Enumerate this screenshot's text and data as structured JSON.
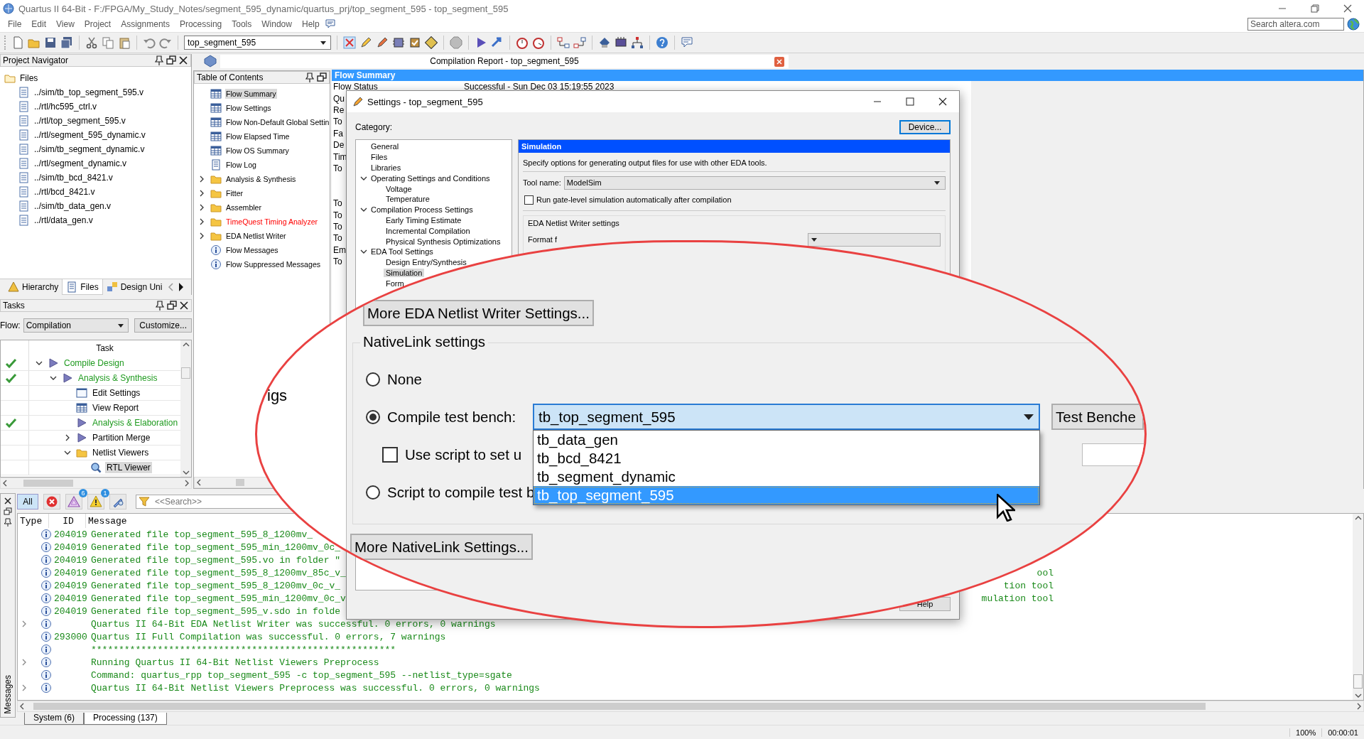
{
  "window": {
    "title": "Quartus II 64-Bit - F:/FPGA/My_Study_Notes/segment_595_dynamic/quartus_prj/top_segment_595 - top_segment_595"
  },
  "menu": [
    "File",
    "Edit",
    "View",
    "Project",
    "Assignments",
    "Processing",
    "Tools",
    "Window",
    "Help"
  ],
  "search": {
    "placeholder": "Search altera.com"
  },
  "toolbar": {
    "project_combo": "top_segment_595"
  },
  "project_navigator": {
    "title": "Project Navigator",
    "root": "Files",
    "files": [
      "../sim/tb_top_segment_595.v",
      "../rtl/hc595_ctrl.v",
      "../rtl/top_segment_595.v",
      "../rtl/segment_595_dynamic.v",
      "../sim/tb_segment_dynamic.v",
      "../rtl/segment_dynamic.v",
      "../sim/tb_bcd_8421.v",
      "../rtl/bcd_8421.v",
      "../sim/tb_data_gen.v",
      "../rtl/data_gen.v"
    ],
    "tabs": [
      {
        "label": "Hierarchy",
        "kind": "hierarchy",
        "selected": false
      },
      {
        "label": "Files",
        "kind": "files",
        "selected": true
      },
      {
        "label": "Design Uni",
        "kind": "units",
        "selected": false
      }
    ]
  },
  "tasks": {
    "title": "Tasks",
    "flow_label": "Flow:",
    "flow": "Compilation",
    "customize": "Customize...",
    "column": "Task",
    "items": [
      {
        "label": "Compile Design",
        "kind": "flow",
        "done": true,
        "selected": false,
        "expanded": true,
        "children": [
          {
            "label": "Analysis & Synthesis",
            "kind": "flow",
            "done": true,
            "selected": false,
            "expanded": true,
            "children": [
              {
                "label": "Edit Settings",
                "kind": "settings",
                "done": false,
                "selected": false
              },
              {
                "label": "View Report",
                "kind": "report",
                "done": false,
                "selected": false
              },
              {
                "label": "Analysis & Elaboration",
                "kind": "flow",
                "done": true,
                "selected": false
              },
              {
                "label": "Partition Merge",
                "kind": "flow",
                "done": false,
                "selected": false,
                "expanded": false
              },
              {
                "label": "Netlist Viewers",
                "kind": "folder",
                "done": false,
                "selected": false,
                "expanded": true,
                "children": [
                  {
                    "label": "RTL Viewer",
                    "kind": "viewer",
                    "done": false,
                    "selected": true
                  }
                ]
              }
            ]
          }
        ]
      }
    ]
  },
  "report_tab": {
    "title": "Compilation Report - top_segment_595"
  },
  "toc": {
    "title": "Table of Contents",
    "items": [
      {
        "label": "Flow Summary",
        "kind": "table",
        "selected": true,
        "failed": false
      },
      {
        "label": "Flow Settings",
        "kind": "table",
        "selected": false,
        "failed": false
      },
      {
        "label": "Flow Non-Default Global Settin",
        "kind": "table",
        "selected": false,
        "failed": false
      },
      {
        "label": "Flow Elapsed Time",
        "kind": "table",
        "selected": false,
        "failed": false
      },
      {
        "label": "Flow OS Summary",
        "kind": "table",
        "selected": false,
        "failed": false
      },
      {
        "label": "Flow Log",
        "kind": "log",
        "selected": false,
        "failed": false
      },
      {
        "label": "Analysis & Synthesis",
        "kind": "folder",
        "expanded": false,
        "selected": false,
        "failed": false
      },
      {
        "label": "Fitter",
        "kind": "folder",
        "expanded": false,
        "selected": false,
        "failed": false
      },
      {
        "label": "Assembler",
        "kind": "folder",
        "expanded": false,
        "selected": false,
        "failed": false
      },
      {
        "label": "TimeQuest Timing Analyzer",
        "kind": "folder",
        "expanded": false,
        "selected": false,
        "failed": true
      },
      {
        "label": "EDA Netlist Writer",
        "kind": "folder",
        "expanded": false,
        "selected": false,
        "failed": false
      },
      {
        "label": "Flow Messages",
        "kind": "info",
        "selected": false,
        "failed": false
      },
      {
        "label": "Flow Suppressed Messages",
        "kind": "info",
        "selected": false,
        "failed": false
      }
    ]
  },
  "report": {
    "title": "Flow Summary",
    "rows": [
      {
        "kind": "row",
        "label": "Flow Status",
        "value": "Successful - Sun Dec 03 15:19:55 2023"
      },
      {
        "kind": "row",
        "label": "Qu"
      },
      {
        "kind": "row",
        "label": "Re"
      },
      {
        "kind": "row",
        "label": "To"
      },
      {
        "kind": "row",
        "label": "Fa"
      },
      {
        "kind": "row",
        "label": "De"
      },
      {
        "kind": "row",
        "label": "Tim"
      },
      {
        "kind": "row",
        "label": "To"
      },
      {
        "kind": "blank"
      },
      {
        "kind": "blank"
      },
      {
        "kind": "row",
        "label": "To"
      },
      {
        "kind": "row",
        "label": "To"
      },
      {
        "kind": "row",
        "label": "To"
      },
      {
        "kind": "row",
        "label": "To"
      },
      {
        "kind": "row",
        "label": "Em"
      },
      {
        "kind": "row",
        "label": "To"
      }
    ]
  },
  "dialog": {
    "title": "Settings - top_segment_595",
    "category_label": "Category:",
    "device_button": "Device...",
    "categories": [
      {
        "label": "General",
        "selected": false
      },
      {
        "label": "Files",
        "selected": false
      },
      {
        "label": "Libraries",
        "selected": false
      },
      {
        "label": "Operating Settings and Conditions",
        "selected": false,
        "expanded": true,
        "children": [
          {
            "label": "Voltage",
            "selected": false
          },
          {
            "label": "Temperature",
            "selected": false
          }
        ]
      },
      {
        "label": "Compilation Process Settings",
        "selected": false,
        "expanded": true,
        "children": [
          {
            "label": "Early Timing Estimate",
            "selected": false
          },
          {
            "label": "Incremental Compilation",
            "selected": false
          },
          {
            "label": "Physical Synthesis Optimizations",
            "selected": false
          }
        ]
      },
      {
        "label": "EDA Tool Settings",
        "selected": false,
        "expanded": true,
        "children": [
          {
            "label": "Design Entry/Synthesis",
            "selected": false
          },
          {
            "label": "Simulation",
            "selected": true
          },
          {
            "label": "Form",
            "selected": false
          }
        ]
      }
    ],
    "panel": {
      "title": "Simulation",
      "description": "Specify options for generating output files for use with other EDA tools.",
      "tool_name_label": "Tool name:",
      "tool_name": "ModelSim",
      "gate_level": {
        "label": "Run gate-level simulation automatically after compilation",
        "checked": false
      },
      "netlist_group": "EDA Netlist Writer settings",
      "format_label": "Format f"
    },
    "help_button": "Help"
  },
  "magnifier": {
    "fragment": "igs",
    "more_writer_button": "More EDA Netlist Writer Settings...",
    "group_title": "NativeLink settings",
    "options": [
      {
        "label": "None",
        "selected": false
      },
      {
        "label": "Compile test bench:",
        "selected": true
      },
      {
        "label": "Script to compile test b",
        "selected": false
      }
    ],
    "test_bench_combo": "tb_top_segment_595",
    "test_benches_button": "Test Benche",
    "script_checkbox": {
      "label": "Use script to set u",
      "checked": false
    },
    "dropdown": [
      {
        "label": "tb_data_gen",
        "selected": false
      },
      {
        "label": "tb_bcd_8421",
        "selected": false
      },
      {
        "label": "tb_segment_dynamic",
        "selected": false
      },
      {
        "label": "tb_top_segment_595",
        "selected": true
      }
    ],
    "more_nativelink_button": "More NativeLink Settings..."
  },
  "messages": {
    "side_label": "Messages",
    "filters": [
      {
        "kind": "all",
        "label": "All",
        "selected": true
      },
      {
        "kind": "error",
        "selected": false
      },
      {
        "kind": "critical",
        "count": "6",
        "selected": false
      },
      {
        "kind": "warning",
        "count": "1",
        "selected": false
      },
      {
        "kind": "suppressed",
        "selected": false
      }
    ],
    "search_placeholder": "<<Search>>",
    "columns": [
      "Type",
      "ID",
      "Message"
    ],
    "rows": [
      {
        "id": "204019",
        "text": "Generated file top_segment_595_8_1200mv_",
        "expandable": false
      },
      {
        "id": "204019",
        "text": "Generated file top_segment_595_min_1200mv_0c_",
        "expandable": false
      },
      {
        "id": "204019",
        "text": "Generated file top_segment_595.vo in folder \"",
        "expandable": false
      },
      {
        "id": "204019",
        "text": "Generated file top_segment_595_8_1200mv_85c_v_",
        "tail": "ool",
        "expandable": false
      },
      {
        "id": "204019",
        "text": "Generated file top_segment_595_8_1200mv_0c_v_",
        "tail": "tion tool",
        "expandable": false
      },
      {
        "id": "204019",
        "text": "Generated file top_segment_595_min_1200mv_0c_v",
        "tail": "mulation tool",
        "expandable": false
      },
      {
        "id": "204019",
        "text": "Generated file top_segment_595_v.sdo in folde",
        "expandable": false
      },
      {
        "text": "Quartus II 64-Bit EDA Netlist Writer was successful. 0 errors, 0 warnings",
        "expandable": true
      },
      {
        "id": "293000",
        "text": "Quartus II Full Compilation was successful. 0 errors, 7 warnings",
        "expandable": false
      },
      {
        "text": "*******************************************************",
        "expandable": false
      },
      {
        "text": "Running Quartus II 64-Bit Netlist Viewers Preprocess",
        "expandable": true
      },
      {
        "text": "Command: quartus_rpp top_segment_595 -c top_segment_595 --netlist_type=sgate",
        "expandable": false
      },
      {
        "text": "Quartus II 64-Bit Netlist Viewers Preprocess was successful. 0 errors, 0 warnings",
        "expandable": true
      }
    ],
    "tabs": [
      {
        "label": "System (6)",
        "selected": false
      },
      {
        "label": "Processing (137)",
        "selected": true
      }
    ]
  },
  "status_bar": {
    "zoom": "100%",
    "time": "00:00:01"
  }
}
